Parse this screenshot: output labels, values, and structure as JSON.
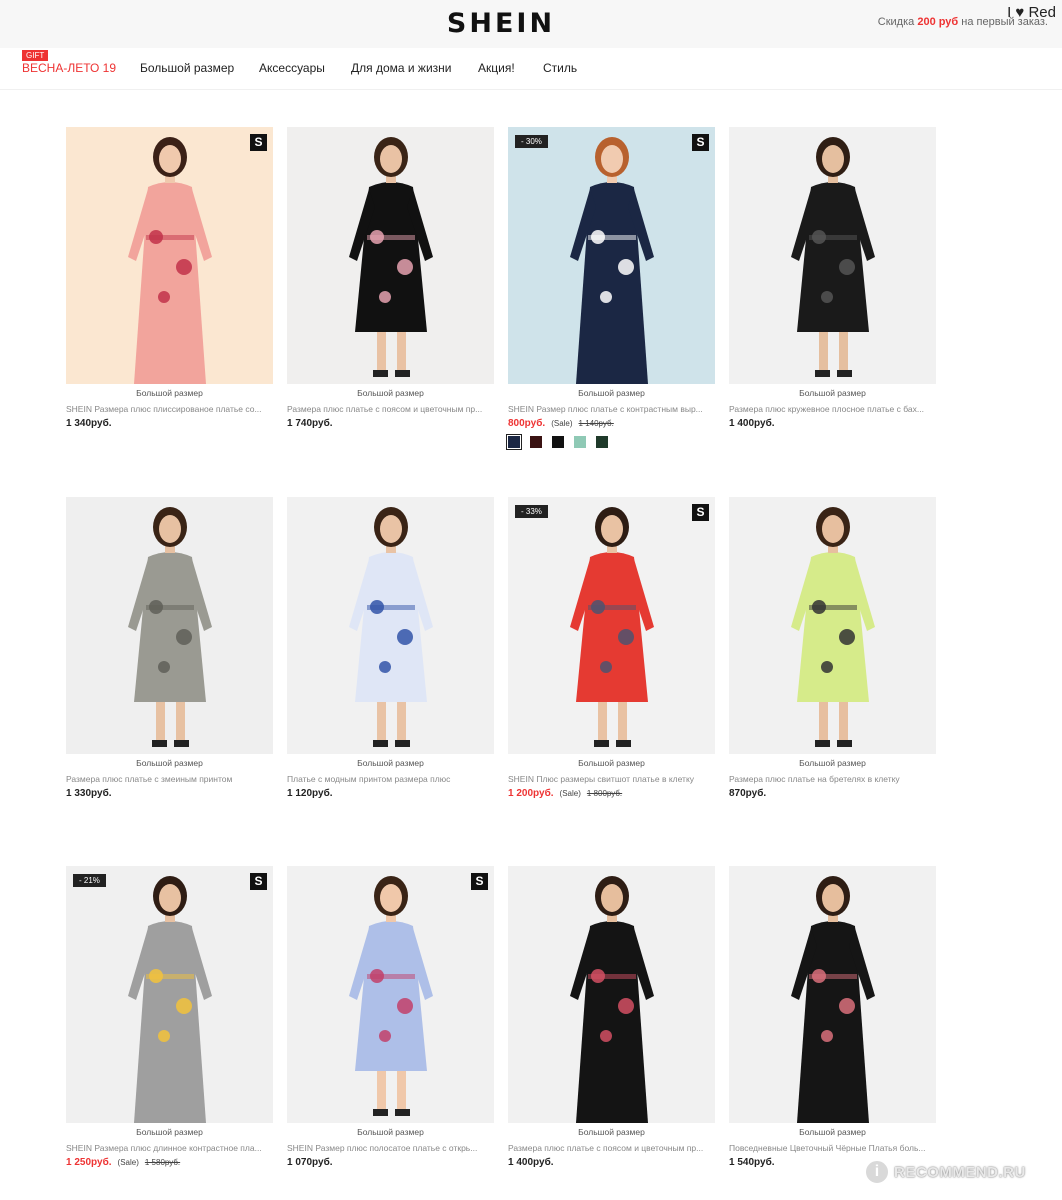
{
  "header": {
    "logo": "SHEIN",
    "promo_prefix": "Скидка ",
    "promo_amount": "200 руб",
    "promo_suffix": " на первый заказ.",
    "corner_text": "I ♥ Red"
  },
  "nav": {
    "gift_badge": "GIFT",
    "items": [
      "ВЕСНА-ЛЕТО 19",
      "Большой размер",
      "Аксессуары",
      "Для дома и жизни",
      "Акция!",
      "Стиль"
    ]
  },
  "products": [
    {
      "label": "Большой размер",
      "title": "SHEIN Размера плюс плиссированое платье со...",
      "price": "1 340руб.",
      "badge": "S",
      "discount": "",
      "sale_tag": "",
      "old_price": "",
      "on_sale": false,
      "bg": "#fbe7d1",
      "dress": "#f2a49c",
      "accent": "#c2334a",
      "skin": "#f0c9ad",
      "hair": "#3b2117",
      "legs": false
    },
    {
      "label": "Большой размер",
      "title": "Размера плюс платье с поясом и цветочным пр...",
      "price": "1 740руб.",
      "badge": "",
      "discount": "",
      "sale_tag": "",
      "old_price": "",
      "on_sale": false,
      "bg": "#f0efee",
      "dress": "#111111",
      "accent": "#e6a2b0",
      "skin": "#e9c2a4",
      "hair": "#3a2416",
      "legs": true
    },
    {
      "label": "Большой размер",
      "title": "SHEIN Размер плюс платье с контрастным выр...",
      "price": "800руб.",
      "badge": "S",
      "discount": "- 30%",
      "sale_tag": "(Sale)",
      "old_price": "1 140руб.",
      "on_sale": true,
      "bg": "#cfe3ea",
      "dress": "#1b2744",
      "accent": "#ffffff",
      "skin": "#f1cbb0",
      "hair": "#b8612e",
      "legs": false
    },
    {
      "label": "Большой размер",
      "title": "Размера плюс кружевное плосное платье с бах...",
      "price": "1 400руб.",
      "badge": "",
      "discount": "",
      "sale_tag": "",
      "old_price": "",
      "on_sale": false,
      "bg": "#f1f1f1",
      "dress": "#1a1a1a",
      "accent": "#555555",
      "skin": "#e5bf9f",
      "hair": "#2f1e14",
      "legs": true
    },
    {
      "label": "Большой размер",
      "title": "Размера плюс платье с змеиным принтом",
      "price": "1 330руб.",
      "badge": "",
      "discount": "",
      "sale_tag": "",
      "old_price": "",
      "on_sale": false,
      "bg": "#efefef",
      "dress": "#9a9a92",
      "accent": "#5f5f58",
      "skin": "#e7c1a2",
      "hair": "#3a2416",
      "legs": true
    },
    {
      "label": "Большой размер",
      "title": "Платье с модным принтом размера плюс",
      "price": "1 120руб.",
      "badge": "",
      "discount": "",
      "sale_tag": "",
      "old_price": "",
      "on_sale": false,
      "bg": "#f1f1f1",
      "dress": "#dfe6f6",
      "accent": "#3354a8",
      "skin": "#e9c3a5",
      "hair": "#3a2416",
      "legs": true
    },
    {
      "label": "Большой размер",
      "title": "SHEIN Плюс размеры свитшот платье в клетку",
      "price": "1 200руб.",
      "badge": "S",
      "discount": "- 33%",
      "sale_tag": "(Sale)",
      "old_price": "1 800руб.",
      "on_sale": true,
      "bg": "#f2f2f2",
      "dress": "#e53a32",
      "accent": "#4d5370",
      "skin": "#e9c2a3",
      "hair": "#2e1d14",
      "legs": true
    },
    {
      "label": "Большой размер",
      "title": "Размера плюс платье на бретелях в клетку",
      "price": "870руб.",
      "badge": "",
      "discount": "",
      "sale_tag": "",
      "old_price": "",
      "on_sale": false,
      "bg": "#f1f1f1",
      "dress": "#d6eb8a",
      "accent": "#333333",
      "skin": "#e7bf9f",
      "hair": "#3a2416",
      "legs": true
    },
    {
      "label": "Большой размер",
      "title": "SHEIN Размера плюс длинное контрастное пла...",
      "price": "1 250руб.",
      "badge": "S",
      "discount": "- 21%",
      "sale_tag": "(Sale)",
      "old_price": "1 580руб.",
      "on_sale": true,
      "bg": "#f0f0f0",
      "dress": "#9f9f9f",
      "accent": "#f2c23b",
      "skin": "#e8c1a2",
      "hair": "#2f1d14",
      "legs": false
    },
    {
      "label": "Большой размер",
      "title": "SHEIN Размер плюс полосатое платье с открь...",
      "price": "1 070руб.",
      "badge": "S",
      "discount": "",
      "sale_tag": "",
      "old_price": "",
      "on_sale": false,
      "bg": "#f1f1f1",
      "dress": "#aebfe8",
      "accent": "#c2406a",
      "skin": "#f0c8aa",
      "hair": "#3a2416",
      "legs": true
    },
    {
      "label": "Большой размер",
      "title": "Размера плюс платье с поясом и цветочным пр...",
      "price": "1 400руб.",
      "badge": "",
      "discount": "",
      "sale_tag": "",
      "old_price": "",
      "on_sale": false,
      "bg": "#f1f1f1",
      "dress": "#141414",
      "accent": "#d24f63",
      "skin": "#e6be9d",
      "hair": "#2e1d14",
      "legs": false
    },
    {
      "label": "Большой размер",
      "title": "Повседневные Цветочный Чёрные Платья боль...",
      "price": "1 540руб.",
      "badge": "",
      "discount": "",
      "sale_tag": "",
      "old_price": "",
      "on_sale": false,
      "bg": "#f1f1f1",
      "dress": "#151515",
      "accent": "#d9707b",
      "skin": "#e6be9d",
      "hair": "#2e1d14",
      "legs": false
    }
  ],
  "swatches_product3": [
    "#1b2744",
    "#3a1212",
    "#111111",
    "#8fc9b5",
    "#1f3a2a"
  ],
  "watermark": {
    "icon_letter": "i",
    "text": "RECOMMEND.RU"
  }
}
